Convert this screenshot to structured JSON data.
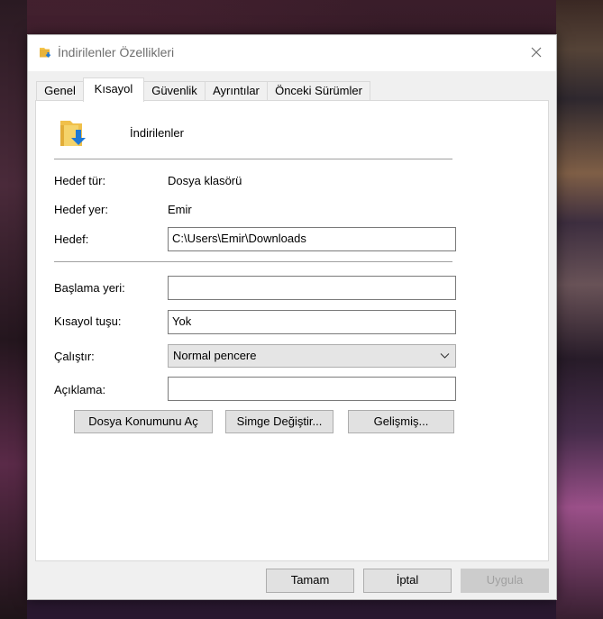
{
  "window": {
    "title": "İndirilenler Özellikleri",
    "title_icon": "folder-download-icon",
    "close_icon": "close-icon"
  },
  "tabs": [
    {
      "label": "Genel"
    },
    {
      "label": "Kısayol",
      "active": true
    },
    {
      "label": "Güvenlik"
    },
    {
      "label": "Ayrıntılar"
    },
    {
      "label": "Önceki Sürümler"
    }
  ],
  "shortcut": {
    "icon": "folder-download-icon",
    "name": "İndirilenler",
    "target_type_label": "Hedef tür:",
    "target_type_value": "Dosya klasörü",
    "target_location_label": "Hedef yer:",
    "target_location_value": "Emir",
    "target_label": "Hedef:",
    "target_value": "C:\\Users\\Emir\\Downloads",
    "start_in_label": "Başlama yeri:",
    "start_in_value": "",
    "shortcut_key_label": "Kısayol tuşu:",
    "shortcut_key_value": "Yok",
    "run_label": "Çalıştır:",
    "run_value": "Normal pencere",
    "comment_label": "Açıklama:",
    "comment_value": "",
    "open_location_label": "Dosya Konumunu Aç",
    "change_icon_label": "Simge Değiştir...",
    "advanced_label": "Gelişmiş..."
  },
  "footer": {
    "ok_label": "Tamam",
    "cancel_label": "İptal",
    "apply_label": "Uygula"
  },
  "colors": {
    "folder_yellow": "#f5c54a",
    "arrow_blue": "#1e78d6",
    "dialog_bg": "#f0f0f0"
  }
}
